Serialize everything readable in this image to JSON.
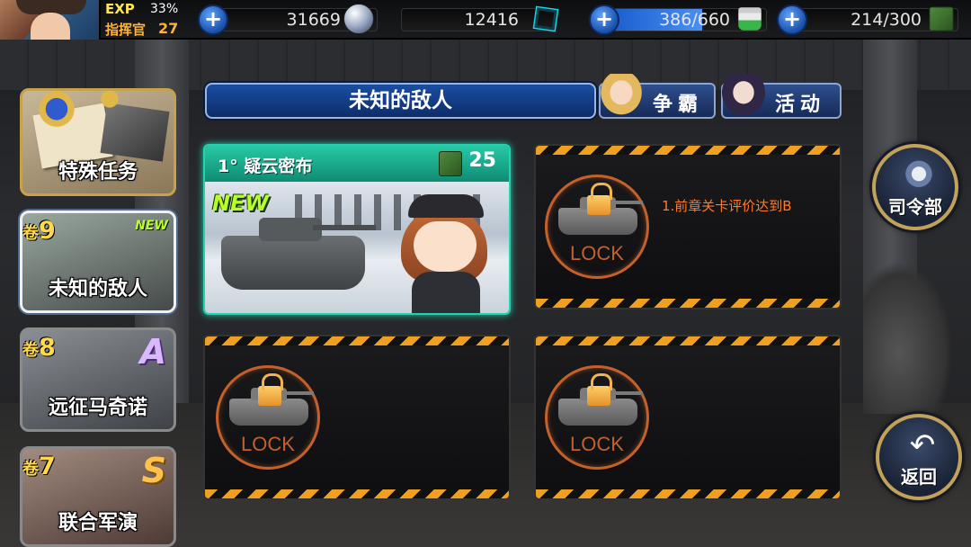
{
  "player": {
    "exp_label": "EXP",
    "exp_percent": "33%",
    "rank_label": "指挥官",
    "level": "27"
  },
  "resources": {
    "ammo": {
      "value": "31669",
      "icon": "ammo-icon"
    },
    "crystal": {
      "value": "12416",
      "icon": "crystal-icon"
    },
    "paint": {
      "value": "386/660",
      "icon": "paint-icon",
      "fill_fraction": 0.585
    },
    "fuel": {
      "value": "214/300",
      "icon": "fuel-icon"
    },
    "plus_label": "+"
  },
  "chapter_title": "未知的敌人",
  "tabs": [
    {
      "label": "争霸"
    },
    {
      "label": "活动"
    }
  ],
  "chapters": [
    {
      "name": "特殊任务"
    },
    {
      "vol_prefix": "卷",
      "vol_num": "9",
      "name": "未知的敌人",
      "badge": "NEW"
    },
    {
      "vol_prefix": "卷",
      "vol_num": "8",
      "name": "远征马奇诺",
      "grade": "A"
    },
    {
      "vol_prefix": "卷",
      "vol_num": "7",
      "name": "联合军演",
      "grade": "S"
    }
  ],
  "missions": [
    {
      "name": "1° 疑云密布",
      "cost": "25",
      "badge": "NEW",
      "locked": false
    },
    {
      "locked": true,
      "lock_text": "LOCK",
      "requirement": "1.前章关卡评价达到B"
    },
    {
      "locked": true,
      "lock_text": "LOCK"
    },
    {
      "locked": true,
      "lock_text": "LOCK"
    }
  ],
  "buttons": {
    "hq": "司令部",
    "back": "返回",
    "back_glyph": "↶"
  },
  "colors": {
    "accent_teal": "#22d3b0",
    "lock_orange": "#c4612a",
    "requirement_orange": "#ff7a2a",
    "exp_yellow": "#ffe35a",
    "gold_border": "#c2a25a"
  }
}
